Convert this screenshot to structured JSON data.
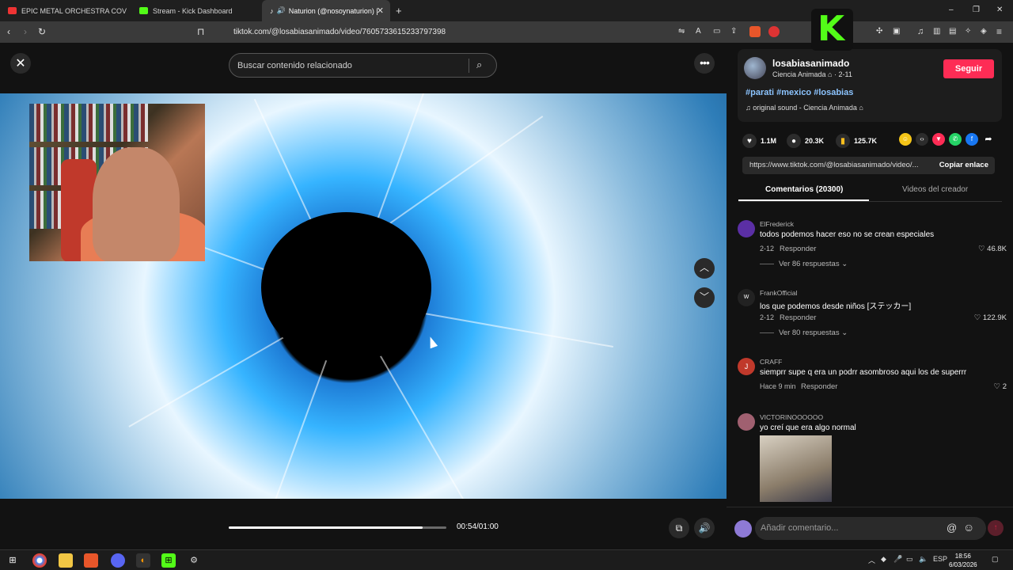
{
  "browser": {
    "tabs": [
      {
        "label": "EPIC METAL ORCHESTRA COVERS | P",
        "fav_color": "#e33",
        "active": false
      },
      {
        "label": "Stream - Kick Dashboard",
        "fav_color": "#53fc18",
        "active": false
      },
      {
        "label": "Naturion (@nosoynaturion) |",
        "fav_color": "#fff",
        "active": true
      }
    ],
    "new_tab": "+",
    "url": "tiktok.com/@losabiasanimado/video/7605733615233797398",
    "window_controls": {
      "minimize": "–",
      "restore": "❐",
      "close": "✕"
    }
  },
  "page": {
    "close_label": "✕",
    "search_placeholder": "Buscar contenido relacionado",
    "more_label": "•••",
    "time": "00:54/01:00",
    "progress": 0.89
  },
  "creator": {
    "username": "losabiasanimado",
    "subline": "Ciencia Animada ⌂ · 2-11",
    "follow_label": "Seguir",
    "hashtags": "#parati #mexico #losabias",
    "sound": "♫  original sound - Ciencia Animada ⌂"
  },
  "stats": {
    "likes": "1.1M",
    "comments": "20.3K",
    "saves": "125.7K"
  },
  "link": {
    "url": "https://www.tiktok.com/@losabiasanimado/video/...",
    "copy_label": "Copiar enlace"
  },
  "side_tabs": {
    "comments": "Comentarios (20300)",
    "creator_videos": "Videos del creador"
  },
  "comments": [
    {
      "name": "ElFrederick",
      "text": "todos podemos hacer eso no se crean especiales",
      "date": "2-12",
      "reply": "Responder",
      "likes": "46.8K",
      "more": "Ver 86 respuestas ⌄",
      "avatar_color": "#5b2fa5"
    },
    {
      "name": "FrankOfficial",
      "text": "los que podemos desde niños [ステッカー]",
      "date": "2-12",
      "reply": "Responder",
      "likes": "122.9K",
      "more": "Ver 80 respuestas ⌄",
      "avatar_color": "#222"
    },
    {
      "name": "CRAFF",
      "text": "siemprr supe q era un podrr asombroso aqui los de superrr",
      "date": "Hace 9 min",
      "reply": "Responder",
      "likes": "2",
      "more": "",
      "avatar_color": "#c0392b",
      "avatar_letter": "J"
    },
    {
      "name": "VICTORINOOOOOO",
      "text": "yo creí que era algo normal",
      "date": "",
      "reply": "",
      "likes": "",
      "more": "",
      "avatar_color": "#a06070"
    }
  ],
  "composer": {
    "placeholder": "Añadir comentario...",
    "at": "@",
    "emoji": "☺",
    "send": "↑"
  },
  "taskbar": {
    "time": "18:56",
    "date": "6/03/2026",
    "lang": "ESP"
  }
}
